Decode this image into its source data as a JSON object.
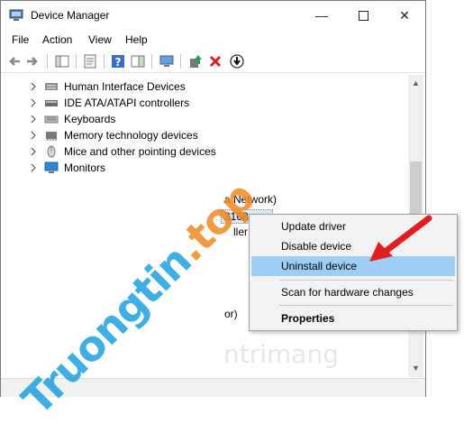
{
  "window": {
    "title": "Device Manager"
  },
  "menu": [
    "File",
    "Action",
    "View",
    "Help"
  ],
  "tree_items": [
    {
      "label": "Human Interface Devices",
      "icon": "hid-icon"
    },
    {
      "label": "IDE ATA/ATAPI controllers",
      "icon": "ide-controller-icon"
    },
    {
      "label": "Keyboards",
      "icon": "keyboard-icon"
    },
    {
      "label": "Memory technology devices",
      "icon": "memory-chip-icon"
    },
    {
      "label": "Mice and other pointing devices",
      "icon": "mouse-icon"
    },
    {
      "label": "Monitors",
      "icon": "monitor-icon"
    }
  ],
  "partial_text": {
    "network": "a Network)",
    "device_num": "3168",
    "controller": "ller",
    "processor": "or)"
  },
  "context_menu": {
    "items": [
      {
        "label": "Update driver"
      },
      {
        "label": "Disable device"
      },
      {
        "label": "Uninstall device",
        "highlighted": true
      },
      {
        "label": "Scan for hardware changes"
      },
      {
        "label": "Properties",
        "bold": true
      }
    ]
  },
  "watermark": {
    "part1": "Truongtin",
    "part2": ".top",
    "gray": "ntrimang"
  },
  "colors": {
    "highlight": "#9ecdf5",
    "arrow": "#e02020",
    "watermark_blue": "#1ea0dd",
    "watermark_orange": "#f08a24"
  }
}
